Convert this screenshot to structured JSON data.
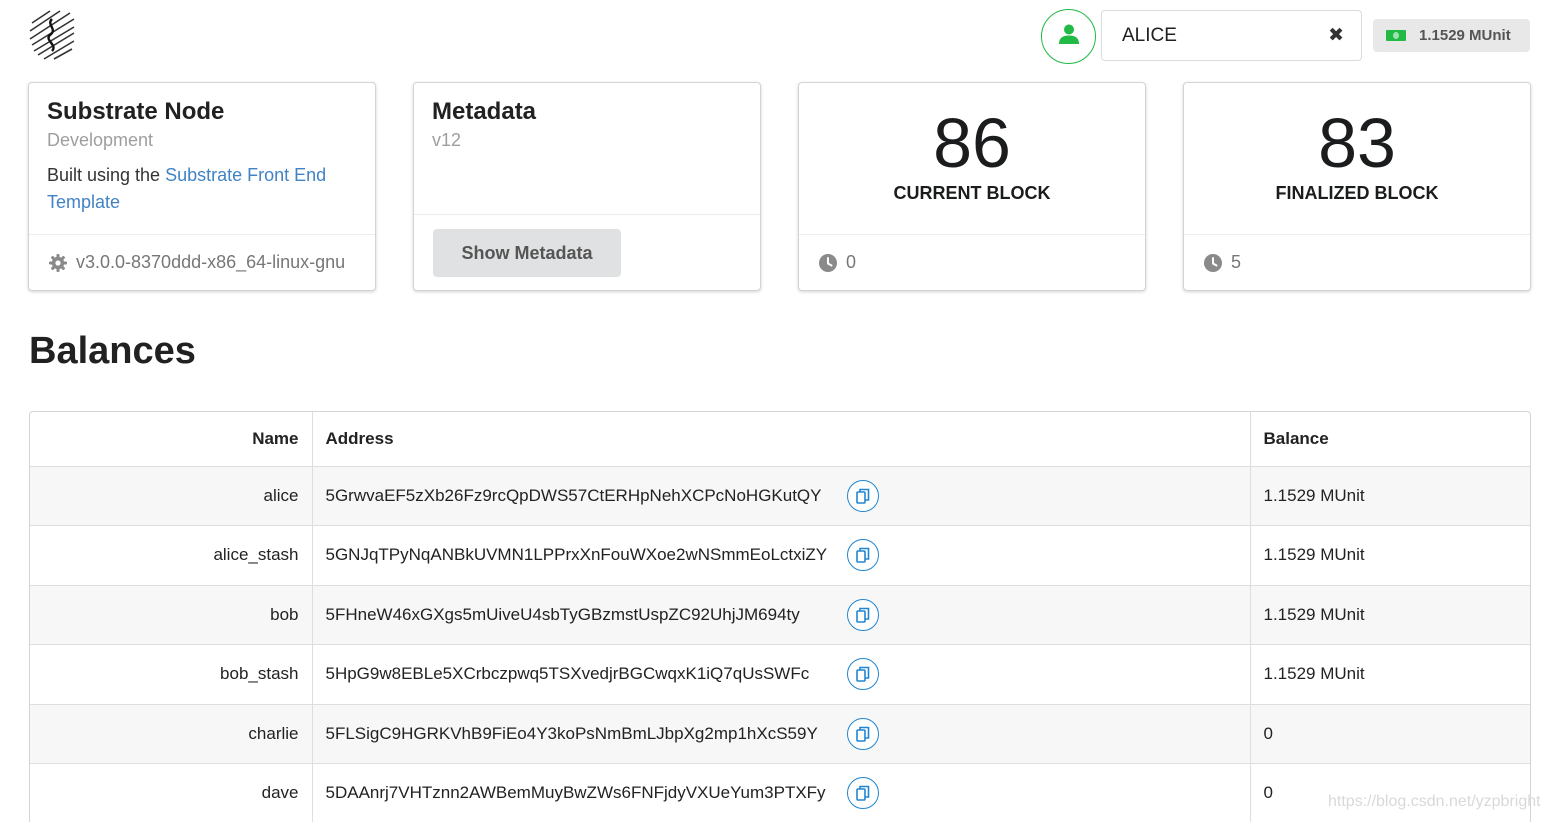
{
  "header": {
    "account": "ALICE",
    "balance": "1.1529 MUnit",
    "icons": {
      "logo": "substrate-logo",
      "account": "user-icon",
      "clear": "close-icon",
      "balance": "money-icon"
    }
  },
  "cards": {
    "node": {
      "title": "Substrate Node",
      "meta": "Development",
      "desc_prefix": "Built using the ",
      "desc_link": "Substrate Front End Template",
      "version": "v3.0.0-8370ddd-x86_64-linux-gnu"
    },
    "metadata": {
      "title": "Metadata",
      "version": "v12",
      "button": "Show Metadata"
    },
    "current_block": {
      "value": "86",
      "label": "CURRENT BLOCK",
      "timer": "0"
    },
    "finalized_block": {
      "value": "83",
      "label": "FINALIZED BLOCK",
      "timer": "5"
    }
  },
  "balances": {
    "title": "Balances",
    "columns": [
      "Name",
      "Address",
      "Balance"
    ],
    "rows": [
      {
        "name": "alice",
        "address": "5GrwvaEF5zXb26Fz9rcQpDWS57CtERHpNehXCPcNoHGKutQY",
        "balance": "1.1529 MUnit"
      },
      {
        "name": "alice_stash",
        "address": "5GNJqTPyNqANBkUVMN1LPPrxXnFouWXoe2wNSmmEoLctxiZY",
        "balance": "1.1529 MUnit"
      },
      {
        "name": "bob",
        "address": "5FHneW46xGXgs5mUiveU4sbTyGBzmstUspZC92UhjJM694ty",
        "balance": "1.1529 MUnit"
      },
      {
        "name": "bob_stash",
        "address": "5HpG9w8EBLe5XCrbczpwq5TSXvedjrBGCwqxK1iQ7qUsSWFc",
        "balance": "1.1529 MUnit"
      },
      {
        "name": "charlie",
        "address": "5FLSigC9HGRKVhB9FiEo4Y3koPsNmBmLJbpXg2mp1hXcS59Y",
        "balance": "0"
      },
      {
        "name": "dave",
        "address": "5DAAnrj7VHTznn2AWBemMuyBwZWs6FNFjdyVXUeYum3PTXFy",
        "balance": "0"
      }
    ]
  },
  "watermark": "https://blog.csdn.net/yzpbright"
}
